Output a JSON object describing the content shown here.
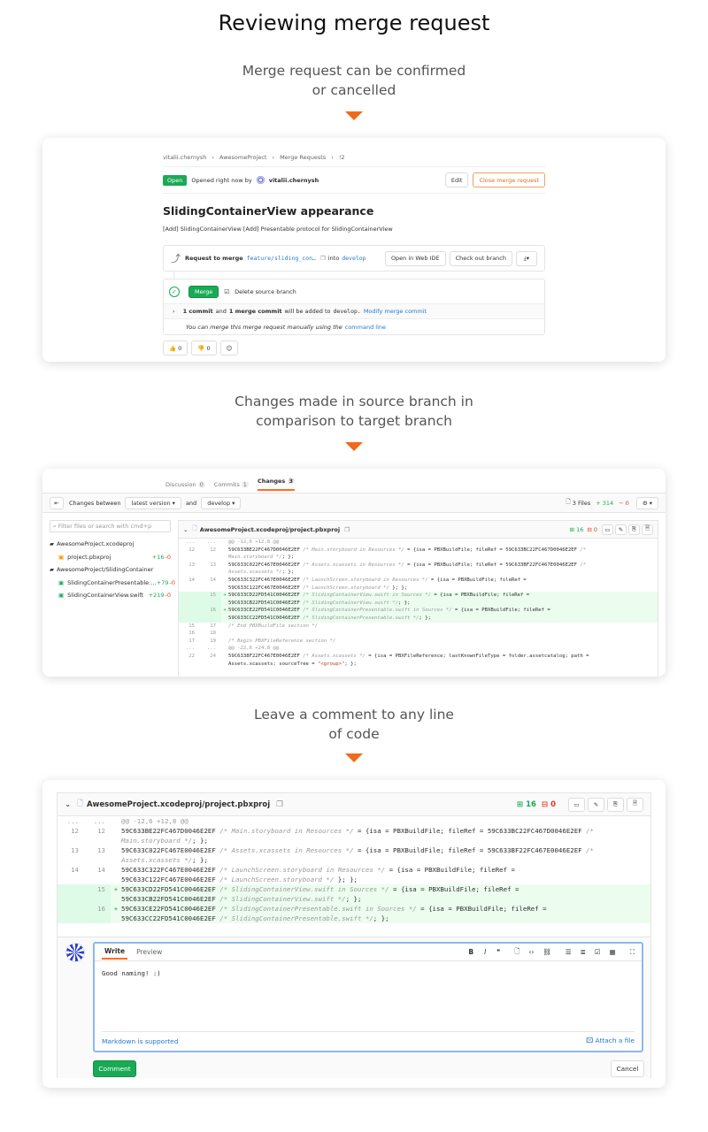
{
  "section1": {
    "title": "Reviewing merge request",
    "caption_l1": "Merge request can be confirmed",
    "caption_l2": "or cancelled"
  },
  "section2": {
    "caption_l1": "Changes made in source branch in",
    "caption_l2": "comparison to target branch"
  },
  "section3": {
    "caption_l1": "Leave a comment to any line",
    "caption_l2": "of code"
  },
  "mr": {
    "breadcrumb": [
      "vitalii.chernysh",
      "AwesomeProject",
      "Merge Requests",
      "!2"
    ],
    "status": "Open",
    "opened_text": "Opened right now by",
    "author": "vitalii.chernysh",
    "edit_label": "Edit",
    "close_label": "Close merge request",
    "title": "SlidingContainerView appearance",
    "description": "[Add] SlidingContainerView [Add] Presentable protocol for SlidingContainerView",
    "request_to_merge": "Request to merge",
    "source_branch": "feature/sliding_con…",
    "into": "into",
    "target_branch": "develop",
    "open_ide": "Open in Web IDE",
    "checkout": "Check out branch",
    "merge_label": "Merge",
    "delete_source": "Delete source branch",
    "commit_count": "1 commit",
    "and": "and",
    "merge_commit": "1 merge commit",
    "will_be_added": "will be added to",
    "develop": "develop.",
    "modify": "Modify merge commit",
    "manual_text": "You can merge this merge request manually using the",
    "command_line": "command line",
    "thumbs_up": "0",
    "thumbs_down": "0"
  },
  "changes": {
    "tabs": [
      {
        "label": "Discussion",
        "count": "0"
      },
      {
        "label": "Commits",
        "count": "1"
      },
      {
        "label": "Changes",
        "count": "3"
      }
    ],
    "changes_between": "Changes between",
    "version": "latest version",
    "and": "and",
    "target": "develop",
    "files_count": "3 Files",
    "additions": "+ 314",
    "deletions": "− 0",
    "filter_placeholder": "Filter files or search with cmd+p",
    "tree": [
      {
        "type": "folder",
        "label": "AwesomeProject.xcodeproj"
      },
      {
        "type": "file",
        "label": "project.pbxproj",
        "add": "+16",
        "del": "-0",
        "mode": "mod"
      },
      {
        "type": "folder",
        "label": "AwesomeProject/SlidingContainer"
      },
      {
        "type": "file",
        "label": "SlidingContainerPresentable.…",
        "add": "+79",
        "del": "-0",
        "mode": "new"
      },
      {
        "type": "file",
        "label": "SlidingContainerView.swift",
        "add": "+219",
        "del": "-0",
        "mode": "new"
      }
    ],
    "file_name": "AwesomeProject.xcodeproj/project.pbxproj",
    "file_add": "16",
    "file_del": "0",
    "diff": [
      {
        "o": "...",
        "n": "...",
        "t": "meta",
        "code": "@@ -12,6 +12,8 @@"
      },
      {
        "o": "12",
        "n": "12",
        "t": "ctx",
        "code": "                59C633BE22FC467D0046E2EF ",
        "cm": "/* Main.storyboard in Resources */",
        "rest": " = {isa = PBXBuildFile; fileRef = 59C633BC22FC467D0046E2EF ",
        "cm2": "/*",
        "wrap": "Main.storyboard */",
        "end": "; };"
      },
      {
        "o": "13",
        "n": "13",
        "t": "ctx",
        "code": "                59C633C022FC467E0046E2EF ",
        "cm": "/* Assets.xcassets in Resources */",
        "rest": " = {isa = PBXBuildFile; fileRef = 59C633BF22FC467E0046E2EF ",
        "cm2": "/*",
        "wrap": "Assets.xcassets */",
        "end": "; };"
      },
      {
        "o": "14",
        "n": "14",
        "t": "ctx",
        "code": "                59C633C322FC467E0046E2EF ",
        "cm": "/* LaunchScreen.storyboard in Resources */",
        "rest": " = {isa = PBXBuildFile; fileRef = ",
        "cm2": "",
        "wrap0": "59C633C122FC467E0046E2EF ",
        "wrap": "/* LaunchScreen.storyboard */",
        "end": " }; };"
      },
      {
        "o": "",
        "n": "15",
        "t": "add",
        "code": "                59C633CD22FD541C0046E2EF ",
        "cm": "/* SlidingContainerView.swift in Sources */",
        "rest": " = {isa = PBXBuildFile; fileRef = ",
        "cm2": "",
        "wrap0": "59C633CB22FD541C0046E2EF ",
        "wrap": "/* SlidingContainerView.swift */",
        "end": "; };"
      },
      {
        "o": "",
        "n": "16",
        "t": "add",
        "code": "                59C633CE22FD541C0046E2EF ",
        "cm": "/* SlidingContainerPresentable.swift in Sources */",
        "rest": " = {isa = PBXBuildFile; fileRef = ",
        "cm2": "",
        "wrap0": "59C633CC22FD541C0046E2EF ",
        "wrap": "/* SlidingContainerPresentable.swift */",
        "end": "; };"
      }
    ],
    "tail": [
      {
        "o": "15",
        "n": "17",
        "code": "/* End PBXBuildFile section */",
        "cmt": true
      },
      {
        "o": "16",
        "n": "18",
        "code": "",
        "cmt": false
      },
      {
        "o": "17",
        "n": "19",
        "code": "/* Begin PBXFileReference section */",
        "cmt": true
      },
      {
        "o": "...",
        "n": "...",
        "code": "@@ -22,6 +24,8 @@",
        "meta": true
      },
      {
        "o": "22",
        "n": "24",
        "code": "                59C6338F22FC467E0046E2EF /* Assets.xcassets */ = {isa = PBXFileReference; lastKnownFileType = folder.assetcatalog; path =",
        "cmt": false,
        "second": "Assets.xcassets; sourceTree = \"<group>\"; };"
      }
    ]
  },
  "comment": {
    "write_tab": "Write",
    "preview_tab": "Preview",
    "text": "Good naming! :)",
    "markdown": "Markdown is supported",
    "attach": "Attach a file",
    "submit": "Comment",
    "cancel": "Cancel"
  }
}
